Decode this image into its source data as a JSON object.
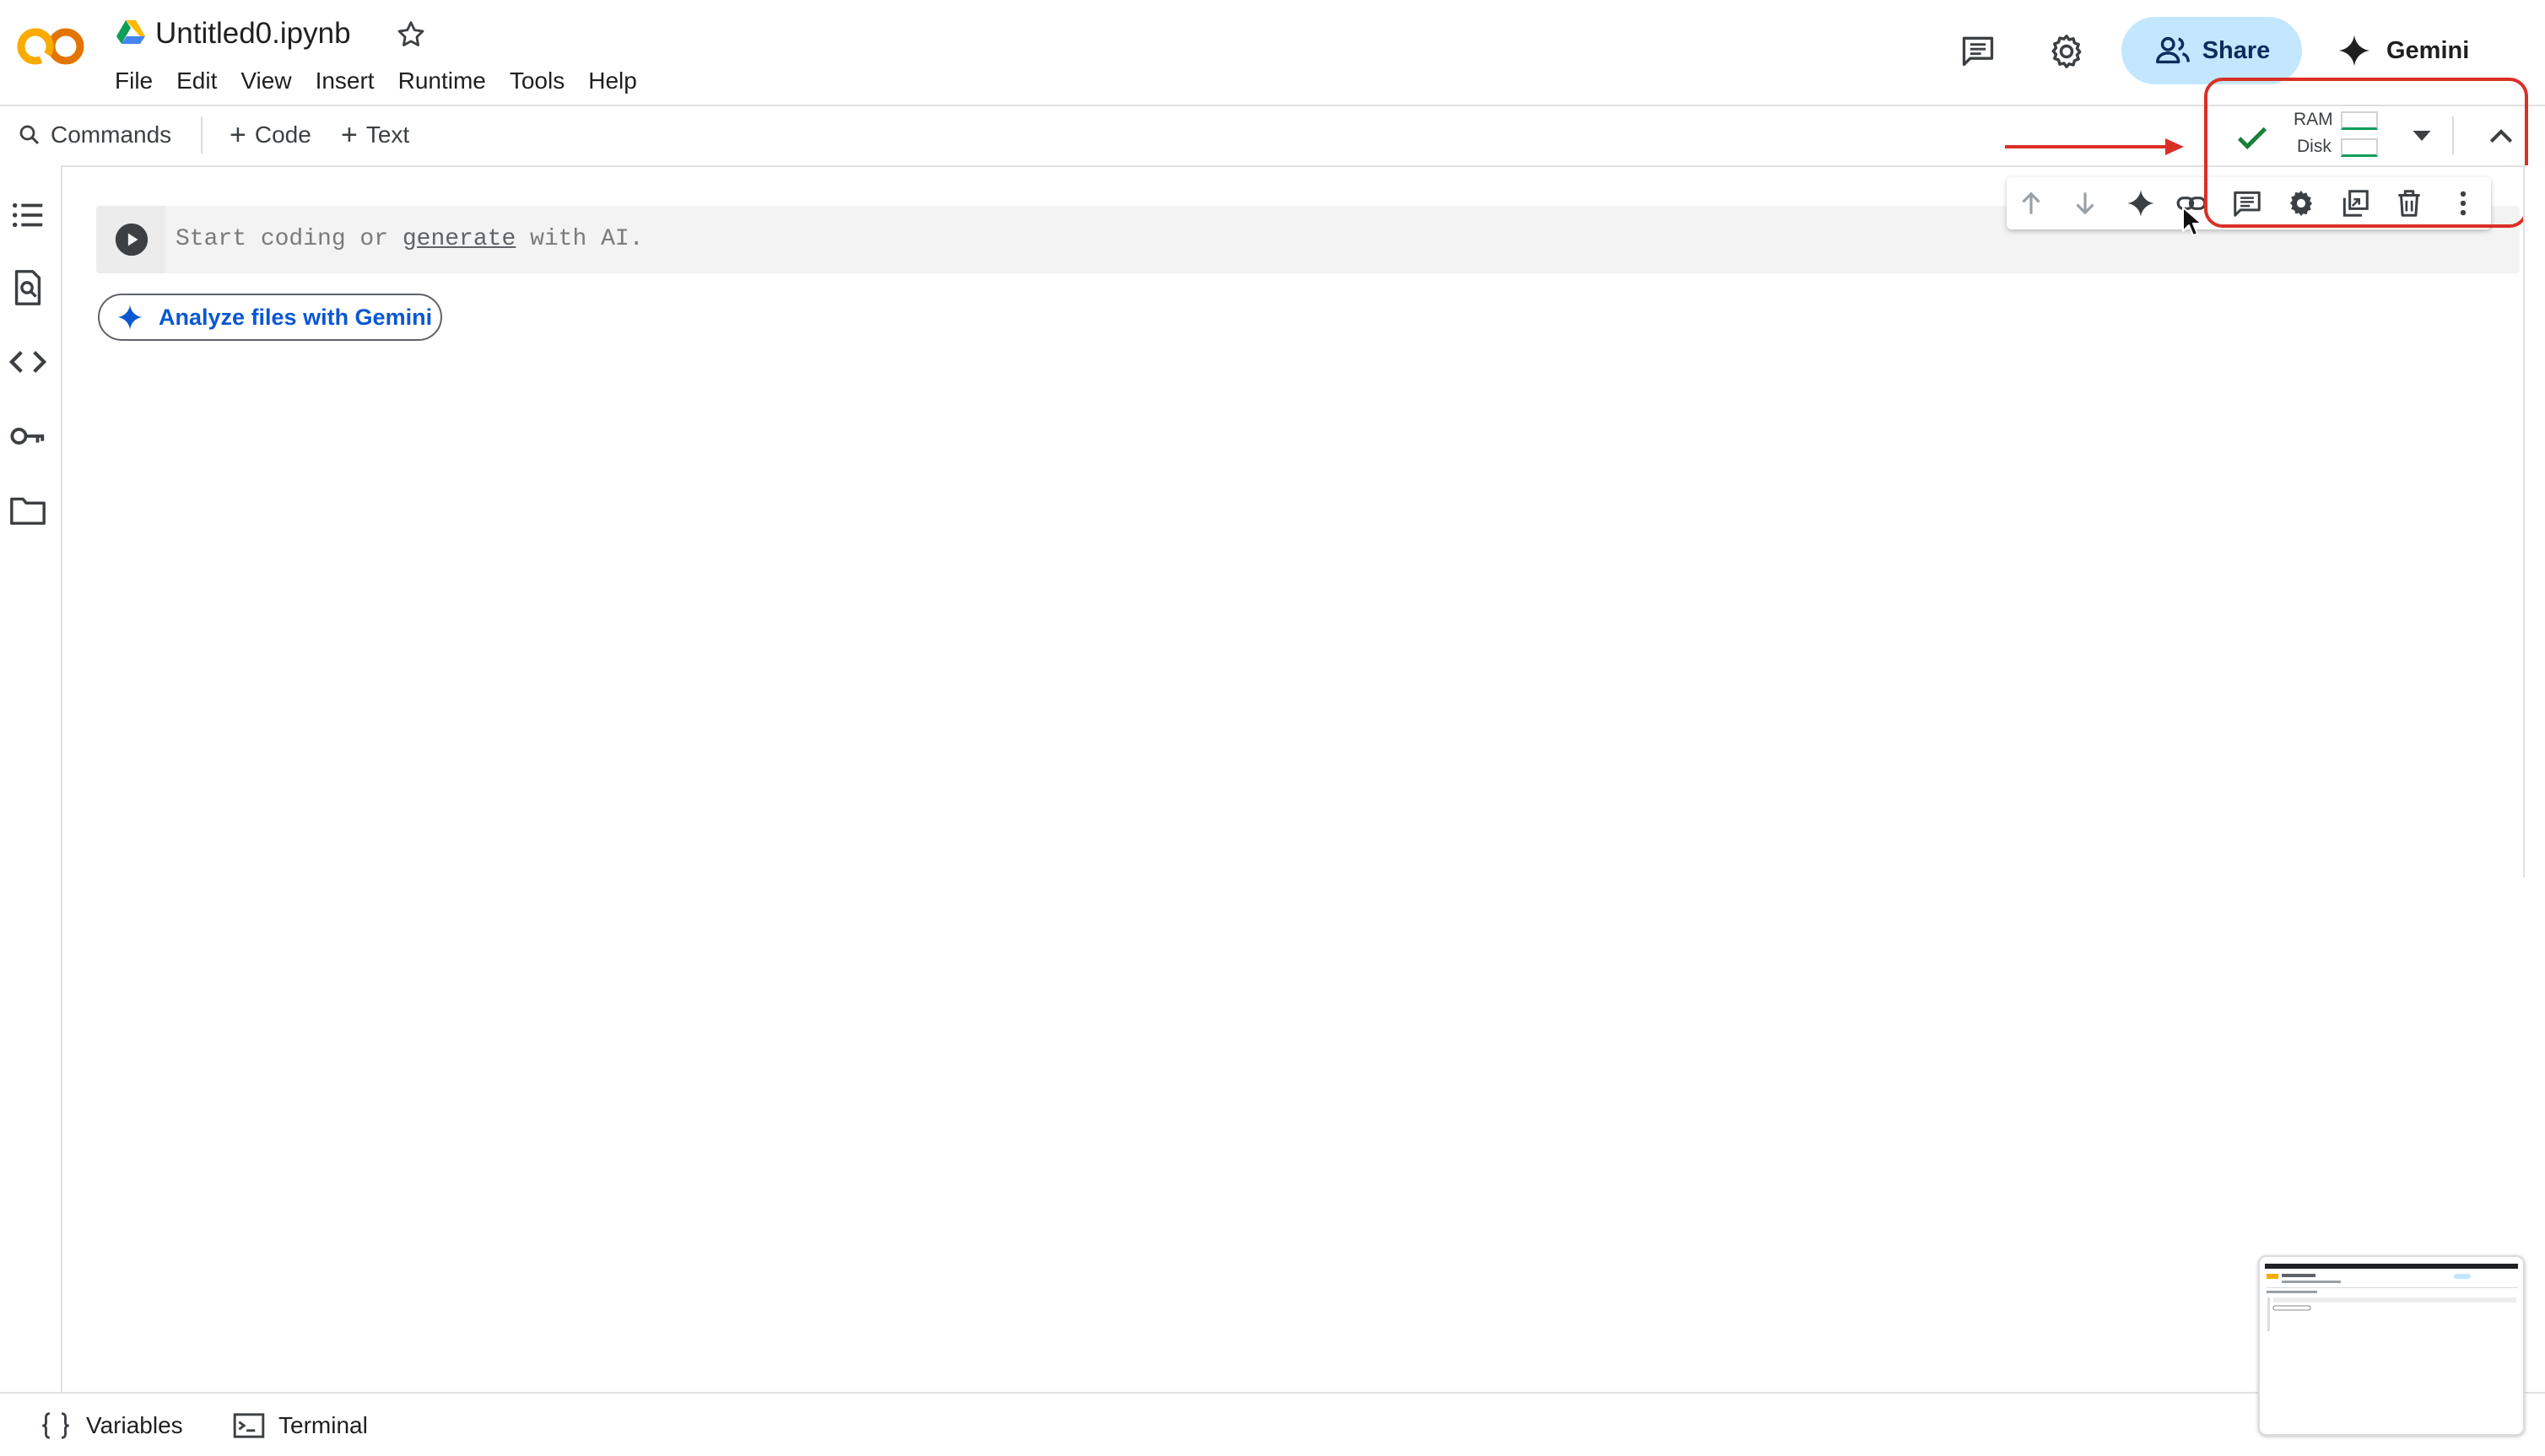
{
  "header": {
    "title": "Untitled0.ipynb",
    "menu": [
      "File",
      "Edit",
      "View",
      "Insert",
      "Runtime",
      "Tools",
      "Help"
    ],
    "share_label": "Share",
    "gemini_label": "Gemini",
    "colors": {
      "share_bg": "#c2e7ff",
      "share_text": "#0b2d5c"
    }
  },
  "toolbar": {
    "commands_label": "Commands",
    "add_code_label": "Code",
    "add_text_label": "Text",
    "runtime": {
      "status": "connected",
      "ram_label": "RAM",
      "disk_label": "Disk",
      "check_color": "#188038"
    }
  },
  "sidebar": {
    "icons": [
      "table-of-contents-icon",
      "find-replace-icon",
      "code-snippets-icon",
      "secrets-key-icon",
      "files-folder-icon"
    ]
  },
  "cell": {
    "placeholder_before": "Start coding or ",
    "placeholder_link": "generate",
    "placeholder_after": " with AI.",
    "toolbar_icons": [
      "move-up-icon",
      "move-down-icon",
      "gemini-sparkle-icon",
      "link-icon",
      "comment-icon",
      "settings-icon",
      "mirror-cell-icon",
      "delete-icon",
      "more-vert-icon"
    ]
  },
  "analyze_button_label": "Analyze files with Gemini",
  "bottom_bar": {
    "variables_label": "Variables",
    "terminal_label": "Terminal"
  },
  "annotation": {
    "color": "#d93025"
  }
}
